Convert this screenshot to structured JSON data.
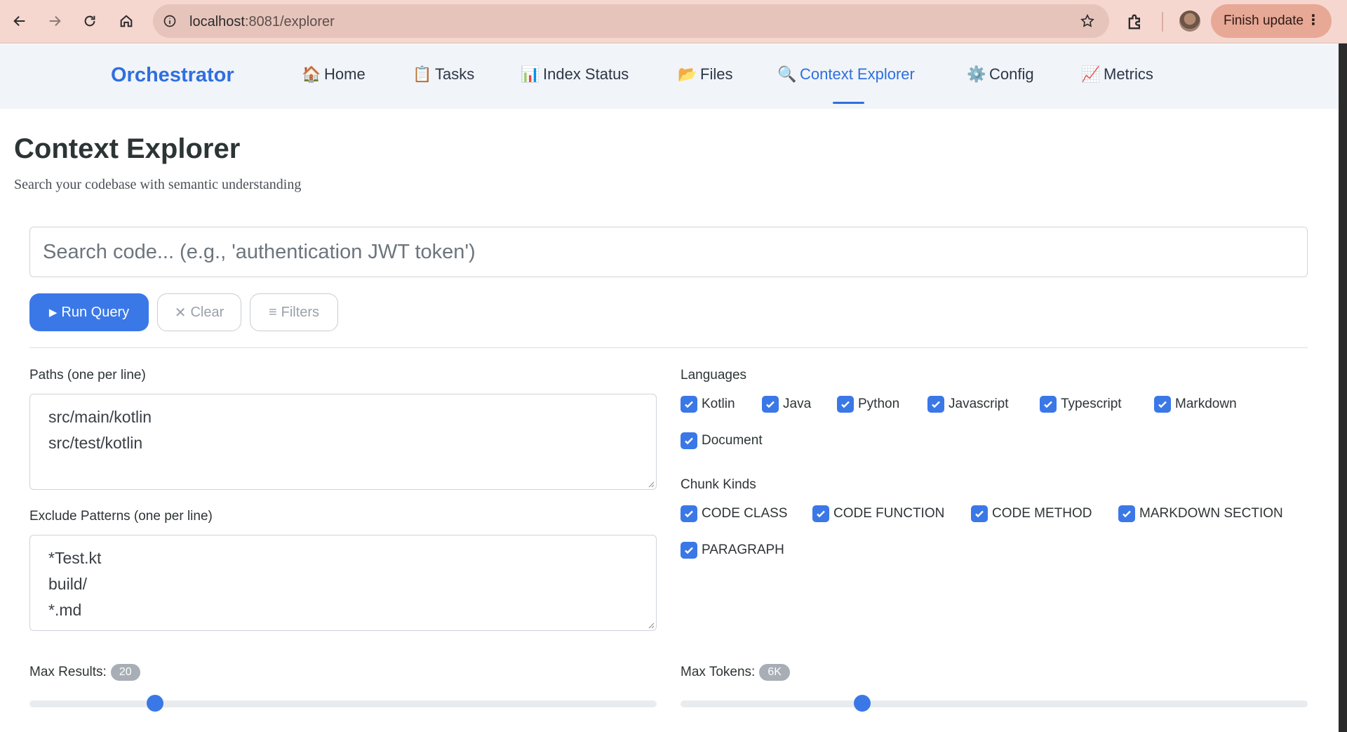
{
  "browser": {
    "url_host": "localhost",
    "url_rest": ":8081/explorer",
    "update_label": "Finish update",
    "icons": [
      "back-icon",
      "forward-icon",
      "reload-icon",
      "home-icon",
      "info-icon",
      "star-icon",
      "extensions-icon"
    ]
  },
  "nav": {
    "brand": "Orchestrator",
    "items": [
      {
        "icon": "🏠",
        "label": "Home"
      },
      {
        "icon": "📋",
        "label": "Tasks"
      },
      {
        "icon": "📊",
        "label": "Index Status"
      },
      {
        "icon": "📂",
        "label": "Files"
      },
      {
        "icon": "🔍",
        "label": "Context Explorer"
      },
      {
        "icon": "⚙️",
        "label": "Config"
      },
      {
        "icon": "📈",
        "label": "Metrics"
      }
    ],
    "active": "Context Explorer"
  },
  "page": {
    "title": "Context Explorer",
    "subtitle": "Search your codebase with semantic understanding"
  },
  "search": {
    "placeholder": "Search code... (e.g., 'authentication JWT token')",
    "value": ""
  },
  "actions": {
    "run_icon": "▶",
    "run_label": "Run Query",
    "clear_icon": "✕",
    "clear_label": "Clear",
    "filters_icon": "≡",
    "filters_label": "Filters"
  },
  "filters": {
    "paths_label": "Paths (one per line)",
    "paths_lines": [
      "src/main/kotlin",
      "src/test/kotlin"
    ],
    "exclude_label": "Exclude Patterns (one per line)",
    "exclude_lines": [
      "*Test.kt",
      "build/",
      "*.md"
    ],
    "languages_label": "Languages",
    "languages": [
      {
        "label": "Kotlin",
        "checked": true
      },
      {
        "label": "Java",
        "checked": true
      },
      {
        "label": "Python",
        "checked": true
      },
      {
        "label": "Javascript",
        "checked": true
      },
      {
        "label": "Typescript",
        "checked": true
      },
      {
        "label": "Markdown",
        "checked": true
      },
      {
        "label": "Document",
        "checked": true
      }
    ],
    "chunk_kinds_label": "Chunk Kinds",
    "chunk_kinds": [
      {
        "label": "CODE CLASS",
        "checked": true
      },
      {
        "label": "CODE FUNCTION",
        "checked": true
      },
      {
        "label": "CODE METHOD",
        "checked": true
      },
      {
        "label": "MARKDOWN SECTION",
        "checked": true
      },
      {
        "label": "PARAGRAPH",
        "checked": true
      }
    ],
    "max_results_label": "Max Results:",
    "max_results_badge": "20",
    "max_results_fraction": 0.2,
    "max_tokens_label": "Max Tokens:",
    "max_tokens_badge": "6K",
    "max_tokens_fraction": 0.29
  },
  "colors": {
    "accent": "#3b78e7",
    "brand": "#2f6fe0",
    "chrome": "#f5d7cf"
  }
}
